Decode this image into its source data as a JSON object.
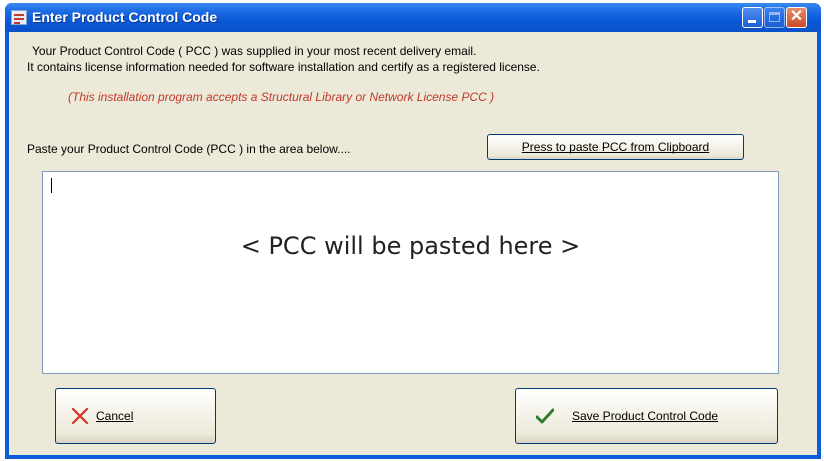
{
  "window": {
    "title": "Enter Product Control Code",
    "icon": "app-form-icon",
    "controls": [
      "minimize-icon",
      "maximize-icon",
      "close-icon"
    ]
  },
  "info": {
    "line1": "Your Product Control Code ( PCC ) was supplied in your most recent delivery email.",
    "line2": "It contains license information needed for software installation and certify as a registered license.",
    "note": "(This installation program accepts a Structural Library or Network License PCC )"
  },
  "paste": {
    "prompt": "Paste your Product Control Code (PCC ) in the area below....",
    "button_label": "Press to paste PCC from Clipboard"
  },
  "pcc_area": {
    "value": "",
    "placeholder": "< PCC will be pasted here >"
  },
  "buttons": {
    "cancel_label": "Cancel",
    "cancel_icon": "x-icon",
    "save_label": "Save Product Control Code",
    "save_icon": "checkmark-icon"
  },
  "colors": {
    "titlebar": "#0a5cd8",
    "dialog_bg": "#ece9d8",
    "note_red": "#c0392b",
    "check_green": "#2e7d32",
    "cancel_x_red": "#d6301f"
  }
}
